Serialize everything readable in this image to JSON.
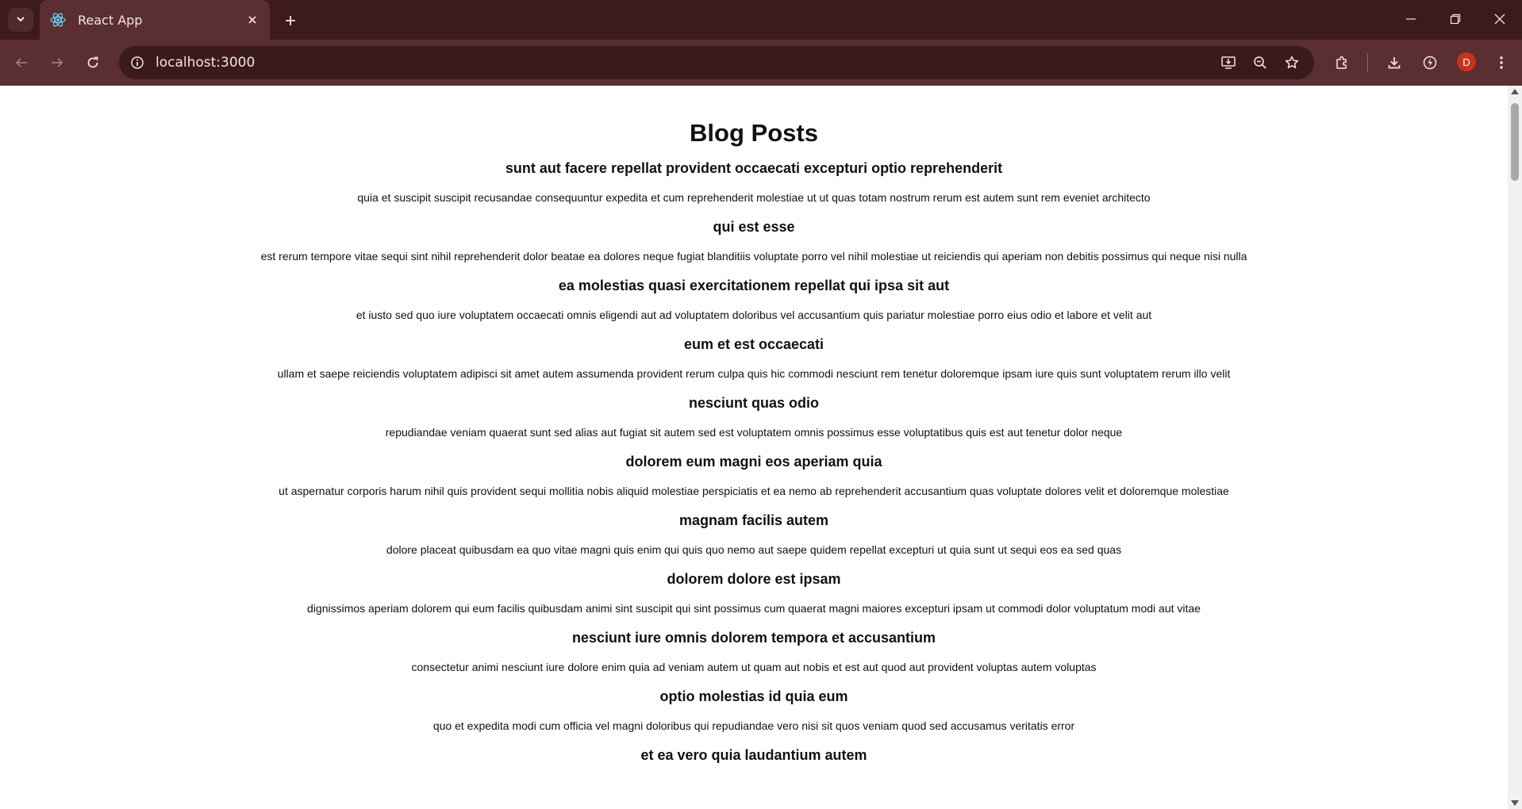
{
  "browser": {
    "tab_title": "React App",
    "url": "localhost:3000",
    "profile_initial": "D",
    "colors": {
      "frame": "#3d1b1d",
      "toolbar": "#5b2e31",
      "avatar": "#c8341b"
    },
    "icons": {
      "tab_list": "chevron-down-icon",
      "favicon": "react-logo-icon",
      "tab_close": "close-icon",
      "new_tab": "plus-icon",
      "minimize": "minimize-icon",
      "restore": "restore-icon",
      "close_window": "close-icon",
      "back": "back-arrow-icon",
      "forward": "forward-arrow-icon",
      "reload": "reload-icon",
      "site_info": "site-info-icon",
      "install": "install-app-icon",
      "zoom": "zoom-out-icon",
      "bookmark": "star-icon",
      "extensions": "puzzle-icon",
      "downloads": "download-icon",
      "performance": "performance-icon"
    }
  },
  "page": {
    "heading": "Blog Posts",
    "posts": [
      {
        "title": "sunt aut facere repellat provident occaecati excepturi optio reprehenderit",
        "body": "quia et suscipit suscipit recusandae consequuntur expedita et cum reprehenderit molestiae ut ut quas totam nostrum rerum est autem sunt rem eveniet architecto"
      },
      {
        "title": "qui est esse",
        "body": "est rerum tempore vitae sequi sint nihil reprehenderit dolor beatae ea dolores neque fugiat blanditiis voluptate porro vel nihil molestiae ut reiciendis qui aperiam non debitis possimus qui neque nisi nulla"
      },
      {
        "title": "ea molestias quasi exercitationem repellat qui ipsa sit aut",
        "body": "et iusto sed quo iure voluptatem occaecati omnis eligendi aut ad voluptatem doloribus vel accusantium quis pariatur molestiae porro eius odio et labore et velit aut"
      },
      {
        "title": "eum et est occaecati",
        "body": "ullam et saepe reiciendis voluptatem adipisci sit amet autem assumenda provident rerum culpa quis hic commodi nesciunt rem tenetur doloremque ipsam iure quis sunt voluptatem rerum illo velit"
      },
      {
        "title": "nesciunt quas odio",
        "body": "repudiandae veniam quaerat sunt sed alias aut fugiat sit autem sed est voluptatem omnis possimus esse voluptatibus quis est aut tenetur dolor neque"
      },
      {
        "title": "dolorem eum magni eos aperiam quia",
        "body": "ut aspernatur corporis harum nihil quis provident sequi mollitia nobis aliquid molestiae perspiciatis et ea nemo ab reprehenderit accusantium quas voluptate dolores velit et doloremque molestiae"
      },
      {
        "title": "magnam facilis autem",
        "body": "dolore placeat quibusdam ea quo vitae magni quis enim qui quis quo nemo aut saepe quidem repellat excepturi ut quia sunt ut sequi eos ea sed quas"
      },
      {
        "title": "dolorem dolore est ipsam",
        "body": "dignissimos aperiam dolorem qui eum facilis quibusdam animi sint suscipit qui sint possimus cum quaerat magni maiores excepturi ipsam ut commodi dolor voluptatum modi aut vitae"
      },
      {
        "title": "nesciunt iure omnis dolorem tempora et accusantium",
        "body": "consectetur animi nesciunt iure dolore enim quia ad veniam autem ut quam aut nobis et est aut quod aut provident voluptas autem voluptas"
      },
      {
        "title": "optio molestias id quia eum",
        "body": "quo et expedita modi cum officia vel magni doloribus qui repudiandae vero nisi sit quos veniam quod sed accusamus veritatis error"
      },
      {
        "title": "et ea vero quia laudantium autem",
        "body": ""
      }
    ]
  }
}
